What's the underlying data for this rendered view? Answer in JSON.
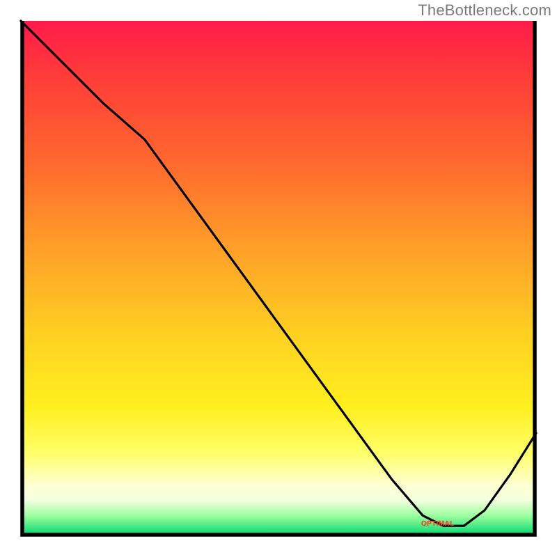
{
  "watermark": "TheBottleneck.com",
  "colors": {
    "line": "#000000",
    "border": "#000000",
    "annotation": "#ff3a1f",
    "gradient_top": "#ff1a4b",
    "gradient_mid": "#ffd321",
    "gradient_bottom": "#08c862"
  },
  "chart_data": {
    "type": "line",
    "title": "",
    "xlabel": "",
    "ylabel": "",
    "xlim": [
      0,
      1
    ],
    "ylim": [
      0,
      1
    ],
    "grid": false,
    "legend": false,
    "annotation": {
      "text": "OPTIMAL",
      "x": 0.8,
      "y": 0.03
    },
    "x": [
      0.0,
      0.08,
      0.16,
      0.24,
      0.32,
      0.4,
      0.48,
      0.56,
      0.64,
      0.72,
      0.78,
      0.82,
      0.86,
      0.9,
      0.95,
      1.0
    ],
    "values": [
      1.0,
      0.92,
      0.84,
      0.77,
      0.66,
      0.55,
      0.44,
      0.33,
      0.22,
      0.11,
      0.04,
      0.02,
      0.02,
      0.05,
      0.12,
      0.2
    ]
  }
}
